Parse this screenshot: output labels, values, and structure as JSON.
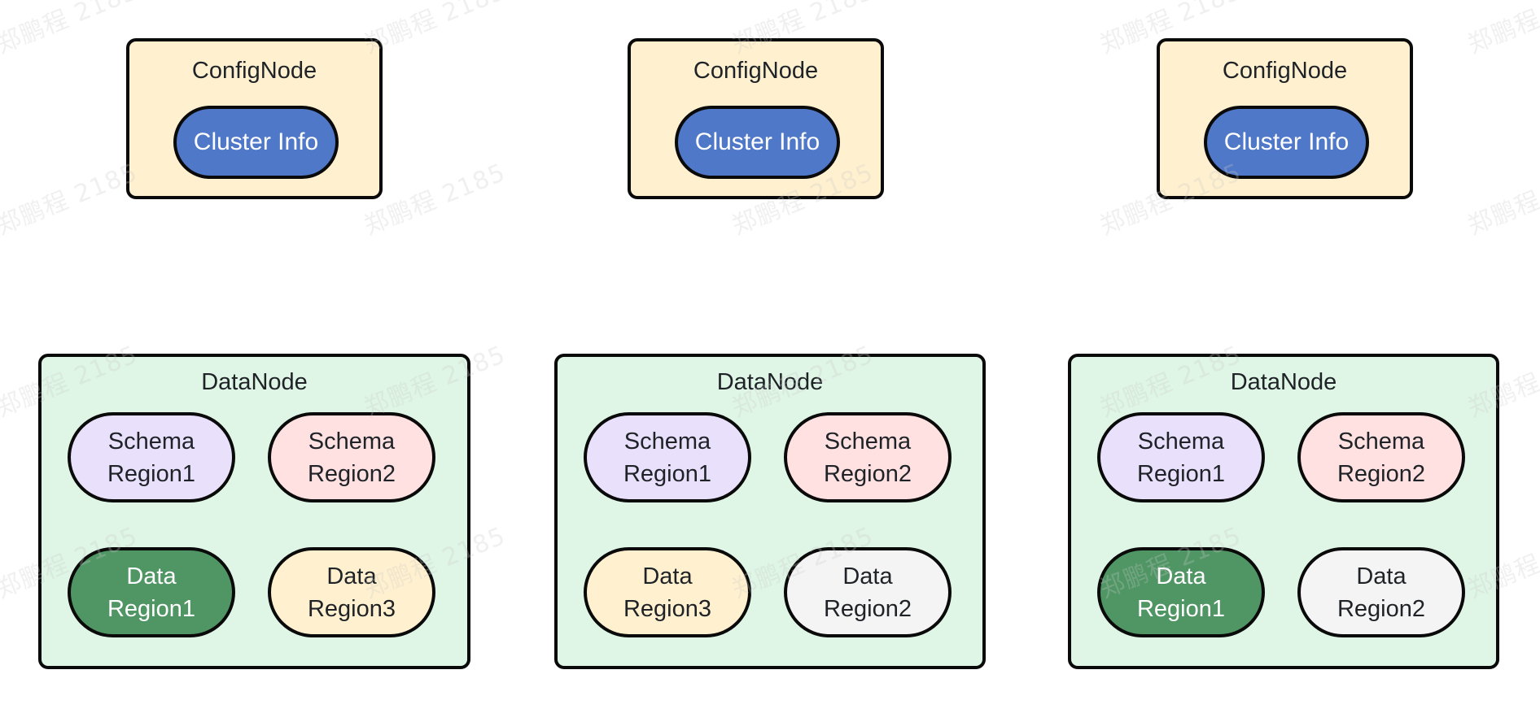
{
  "watermark_text": "郑鹏程 2185",
  "colors": {
    "config_node_bg": "#fff1cf",
    "data_node_bg": "#dff5e5",
    "cluster_info": "#5078c8",
    "schema_region1": "#e9e1fc",
    "schema_region2": "#ffe1e1",
    "data_region1": "#509664",
    "data_region3": "#fff1cf",
    "data_region2": "#f4f4f4",
    "border": "#0a0a0a"
  },
  "config_nodes": [
    {
      "title": "ConfigNode",
      "content": "Cluster Info"
    },
    {
      "title": "ConfigNode",
      "content": "Cluster Info"
    },
    {
      "title": "ConfigNode",
      "content": "Cluster Info"
    }
  ],
  "data_nodes": [
    {
      "title": "DataNode",
      "regions": [
        {
          "line1": "Schema",
          "line2": "Region1",
          "kind": "schema_region1"
        },
        {
          "line1": "Schema",
          "line2": "Region2",
          "kind": "schema_region2"
        },
        {
          "line1": "Data",
          "line2": "Region1",
          "kind": "data_region1"
        },
        {
          "line1": "Data",
          "line2": "Region3",
          "kind": "data_region3"
        }
      ]
    },
    {
      "title": "DataNode",
      "regions": [
        {
          "line1": "Schema",
          "line2": "Region1",
          "kind": "schema_region1"
        },
        {
          "line1": "Schema",
          "line2": "Region2",
          "kind": "schema_region2"
        },
        {
          "line1": "Data",
          "line2": "Region3",
          "kind": "data_region3"
        },
        {
          "line1": "Data",
          "line2": "Region2",
          "kind": "data_region2"
        }
      ]
    },
    {
      "title": "DataNode",
      "regions": [
        {
          "line1": "Schema",
          "line2": "Region1",
          "kind": "schema_region1"
        },
        {
          "line1": "Schema",
          "line2": "Region2",
          "kind": "schema_region2"
        },
        {
          "line1": "Data",
          "line2": "Region1",
          "kind": "data_region1"
        },
        {
          "line1": "Data",
          "line2": "Region2",
          "kind": "data_region2"
        }
      ]
    }
  ]
}
